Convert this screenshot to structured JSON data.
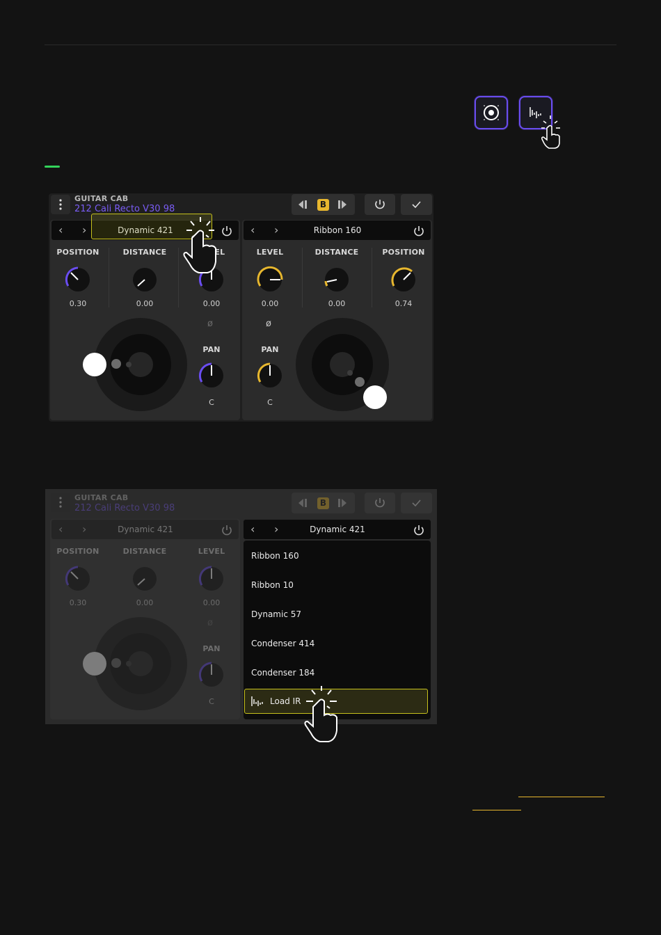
{
  "colors": {
    "accent_purple": "#7a5cf5",
    "accent_yellow": "#e7b72e",
    "highlight_green": "#33d35a",
    "panel": "#2b2b2b",
    "background": "#131313"
  },
  "icons": {
    "cab_icon": "speaker-icon",
    "ir_icon": "impulse-response-icon",
    "pointer": "hand-pointer-icon"
  },
  "panel1": {
    "title": "GUITAR CAB",
    "cab_name": "212 Cali Recto V30 98",
    "ab_label": "B",
    "micA": {
      "name": "Dynamic 421",
      "knobs": [
        {
          "label": "POSITION",
          "value": "0.30"
        },
        {
          "label": "DISTANCE",
          "value": "0.00"
        },
        {
          "label": "LEVEL",
          "value": "0.00"
        }
      ],
      "phase": "ø",
      "pan_label": "PAN",
      "pan_value": "C"
    },
    "micB": {
      "name": "Ribbon 160",
      "knobs": [
        {
          "label": "LEVEL",
          "value": "0.00"
        },
        {
          "label": "DISTANCE",
          "value": "0.00"
        },
        {
          "label": "POSITION",
          "value": "0.74"
        }
      ],
      "phase": "ø",
      "pan_label": "PAN",
      "pan_value": "C"
    }
  },
  "panel2": {
    "title": "GUITAR CAB",
    "cab_name": "212 Cali Recto V30 98",
    "ab_label": "B",
    "micA": {
      "name": "Dynamic 421",
      "knobs": [
        {
          "label": "POSITION",
          "value": "0.30"
        },
        {
          "label": "DISTANCE",
          "value": "0.00"
        },
        {
          "label": "LEVEL",
          "value": "0.00"
        }
      ],
      "phase": "ø",
      "pan_label": "PAN",
      "pan_value": "C"
    },
    "micB": {
      "name": "Dynamic 421"
    },
    "dropdown": {
      "items": [
        "Ribbon 160",
        "Ribbon 10",
        "Dynamic 57",
        "Condenser 414",
        "Condenser 184"
      ],
      "load_ir": "Load IR"
    }
  }
}
